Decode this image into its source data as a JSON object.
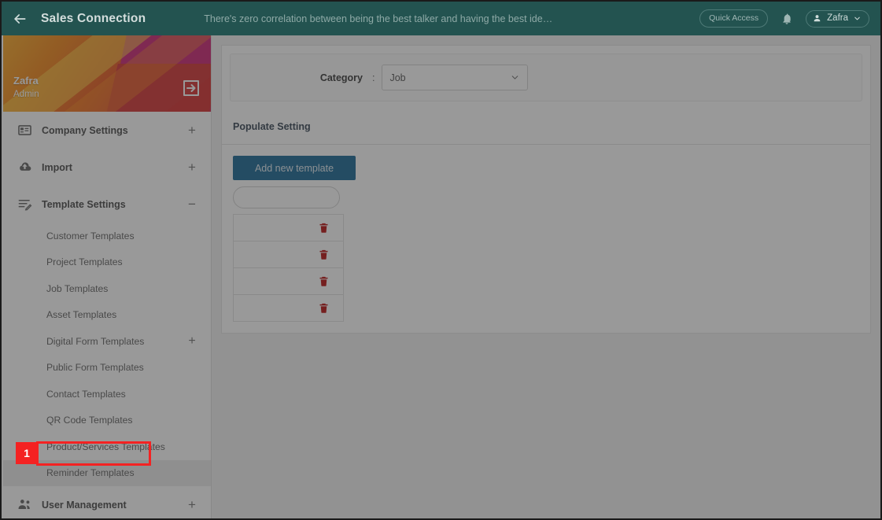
{
  "header": {
    "back_icon": "back-arrow-icon",
    "brand": "Sales Connection",
    "marquee": "There's zero correlation between being the best talker and having the best ide…",
    "quick_access": "Quick Access",
    "bell_icon": "bell-icon",
    "user_name": "Zafra",
    "caret_icon": "chevron-down-icon"
  },
  "sidebar": {
    "profile": {
      "name": "Zafra",
      "role": "Admin",
      "logout_icon": "logout-icon"
    },
    "menu": [
      {
        "label": "Company Settings",
        "icon": "company-settings-icon",
        "expander": "+"
      },
      {
        "label": "Import",
        "icon": "cloud-upload-icon",
        "expander": "+"
      },
      {
        "label": "Template Settings",
        "icon": "template-settings-icon",
        "expander": "−"
      }
    ],
    "template_sub_items": [
      {
        "label": "Customer Templates",
        "expander": ""
      },
      {
        "label": "Project Templates",
        "expander": ""
      },
      {
        "label": "Job Templates",
        "expander": ""
      },
      {
        "label": "Asset Templates",
        "expander": ""
      },
      {
        "label": "Digital Form Templates",
        "expander": "+"
      },
      {
        "label": "Public Form Templates",
        "expander": ""
      },
      {
        "label": "Contact Templates",
        "expander": ""
      },
      {
        "label": "QR Code Templates",
        "expander": ""
      },
      {
        "label": "Product/Services Templates",
        "expander": ""
      },
      {
        "label": "Reminder Templates",
        "expander": ""
      }
    ],
    "bottom_menu": [
      {
        "label": "User Management",
        "icon": "users-icon",
        "expander": "+"
      }
    ]
  },
  "annotation": {
    "step_number": "1",
    "target_label": "Reminder Templates",
    "color": "#f42222"
  },
  "main": {
    "category_label": "Category",
    "category_colon": ":",
    "category_value": "Job",
    "category_caret_icon": "chevron-down-icon",
    "section_title": "Populate Setting",
    "new_template_button": "Add new template",
    "search_placeholder": "",
    "rows": [
      {
        "delete_icon": "trash-icon"
      },
      {
        "delete_icon": "trash-icon"
      },
      {
        "delete_icon": "trash-icon"
      },
      {
        "delete_icon": "trash-icon"
      }
    ]
  },
  "colors": {
    "header_bg": "#235350",
    "accent_blue": "#0b5e8e",
    "danger_red": "#b30000",
    "annotation_red": "#f42222"
  }
}
